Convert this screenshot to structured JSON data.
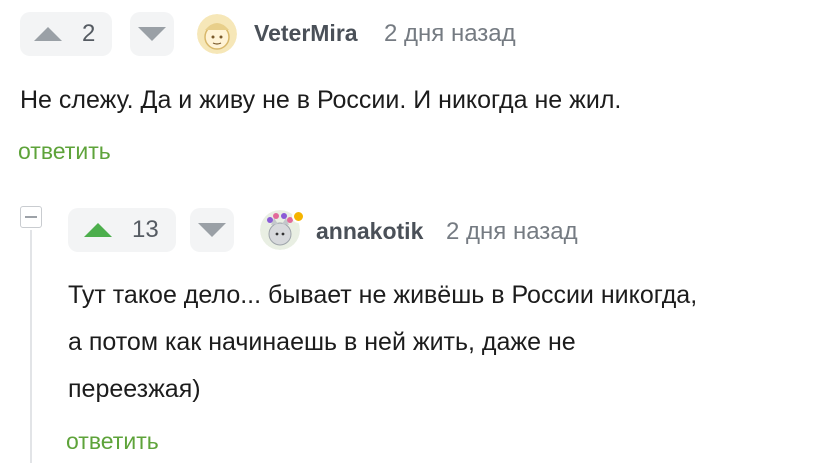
{
  "comments": [
    {
      "score": "2",
      "author": "VeterMira",
      "time": "2 дня назад",
      "text": "Не слежу. Да и живу не в России. И никогда не жил.",
      "reply_label": "ответить",
      "upvote_color": "#9aa0a6"
    },
    {
      "score": "13",
      "author": "annakotik",
      "time": "2 дня назад",
      "text_lines": [
        "Тут такое дело... бывает не живёшь в России никогда,",
        "а потом как начинаешь в ней жить, даже не",
        "переезжая)"
      ],
      "reply_label": "ответить",
      "upvote_color": "#4cae4c",
      "online_badge_color": "#f5b400"
    }
  ],
  "colors": {
    "reply_link": "#5ea33a",
    "downvote_triangle": "#9aa0a6"
  }
}
